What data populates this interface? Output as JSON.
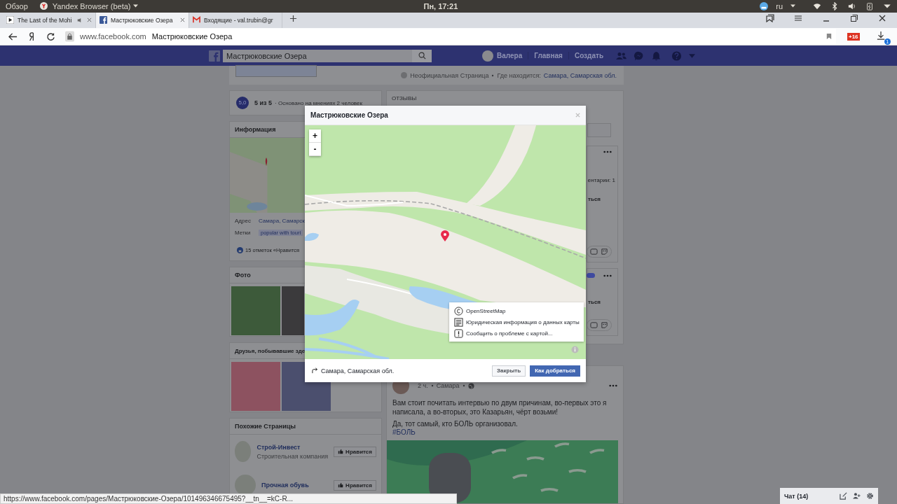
{
  "os_bar": {
    "activities": "Обзор",
    "app_menu": "Yandex Browser (beta)",
    "clock": "Пн, 17:21",
    "keyboard_layout": "ru"
  },
  "browser": {
    "tabs": [
      {
        "title": "The Last of the Mohi",
        "kind": "video",
        "selected": false
      },
      {
        "title": "Мастрюковские Озера",
        "kind": "facebook",
        "selected": true
      },
      {
        "title": "Входящие - val.trubin@gr",
        "kind": "mail",
        "selected": false
      }
    ],
    "address": {
      "domain": "www.facebook.com",
      "page_title": "Мастрюковские Озера"
    },
    "extension_badge": "+16",
    "downloads_badge": "1"
  },
  "facebook_bar": {
    "search_value": "Мастрюковские Озера",
    "user": "Валера",
    "nav": [
      "Главная",
      "Создать"
    ]
  },
  "page_header": {
    "status": "Неофициальная Страница",
    "location_label": "Где находится:",
    "location": "Самара, Самарская обл."
  },
  "rating": {
    "score": "5,0",
    "summary": "5 из 5",
    "basis": "· Основано на мнениях 2 человек"
  },
  "info": {
    "title": "Информация",
    "rows": [
      {
        "label": "Адрес",
        "value": "Самара, Самарск",
        "kind": "link"
      },
      {
        "label": "Метки",
        "value": "popular with touri",
        "kind": "tag"
      }
    ],
    "likes": "15 отметок «Нравится"
  },
  "photos": {
    "title": "Фото"
  },
  "friends": {
    "title": "Друзья, побывавшие зде"
  },
  "similar_pages": {
    "title": "Похожие Страницы",
    "items": [
      {
        "name": "Строй-Инвест",
        "category": "Строительная компания",
        "button": "Нравится"
      },
      {
        "name": "Прочная обувь",
        "button": "Нравится"
      }
    ]
  },
  "reviews": {
    "title": "ОТЗЫВЫ",
    "cards": [
      {
        "comments_fragment": "ентарии: 1",
        "action_fragment": "ться"
      },
      {
        "action_fragment": "ться"
      }
    ]
  },
  "post": {
    "time": "2 ч.",
    "place": "Самара",
    "text": "Вам стоит почитать интервью по двум причинам, во-первых это я написала, а во-вторых, это Казарьян, чёрт возьми!",
    "text2": "Да, тот самый, кто БОЛЬ организовал.",
    "hashtag": "#БОЛЬ"
  },
  "dialog": {
    "title": "Мастрюковские Озера",
    "zoom": [
      "+",
      "-"
    ],
    "attribution": [
      {
        "label": "OpenStreetMap",
        "kind": "copyright"
      },
      {
        "label": "Юридическая информация о данных карты",
        "kind": "legal"
      },
      {
        "label": "Сообщить о проблеме с картой...",
        "kind": "report"
      }
    ],
    "address": "Самара, Самарская обл.",
    "buttons": [
      {
        "label": "Закрыть",
        "kind": "secondary"
      },
      {
        "label": "Как добраться",
        "kind": "primary"
      }
    ]
  },
  "status_url": "https://www.facebook.com/pages/Мастрюковские-Озера/101496346675495?__tn__=kC-R...",
  "chat": {
    "label": "Чат (14)"
  }
}
